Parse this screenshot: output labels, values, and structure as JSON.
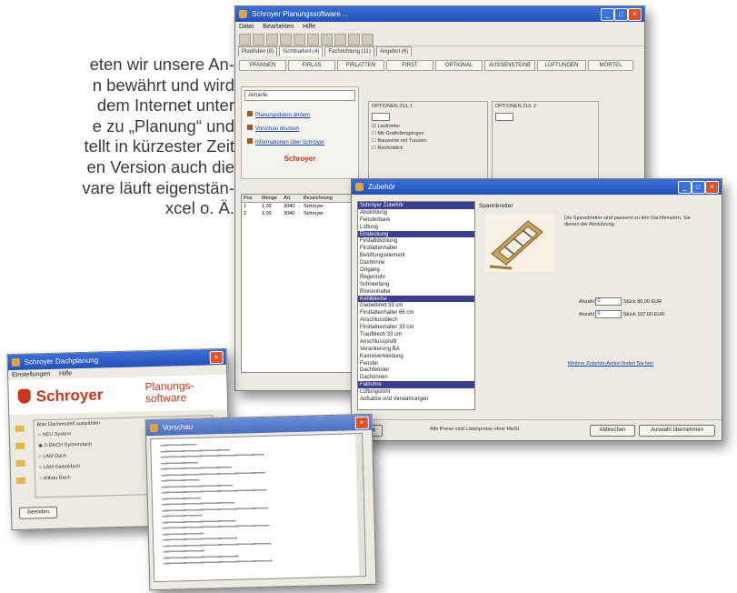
{
  "intro_lines": [
    "eten wir unsere An-",
    "n bewährt und wird",
    "dem Internet unter",
    "e zu „Planung“ und",
    "tellt in kürzester Zeit",
    "en Version auch die",
    "vare läuft eigenstän-",
    "xcel o. Ä."
  ],
  "colors": {
    "titlebar": "#2452b8",
    "brand": "#c8361b",
    "list_highlight": "#3b3f8f"
  },
  "main_window": {
    "title": "Schroyer Planungssoftware ...",
    "menu": [
      "Datei",
      "Bearbeiten",
      "Hilfe"
    ],
    "tabs": [
      "Planlisten (8)",
      "Sichtbarkeit (4)",
      "Fachrichtung (11)",
      "Angebot (6)"
    ],
    "section_bar": [
      "PFANNEN",
      "FIRLAS",
      "FIRLATTEN",
      "FIRST",
      "OPTIONAL",
      "AUSSENSTEINE",
      "LÜFTUNGEN",
      "MÖRTEL"
    ],
    "sidebar_title": "Aktuelle",
    "sidebar_links": [
      "Planungsdaten ändern",
      "Vorschau drucken",
      "Informationen über Schroyer"
    ],
    "sidebar_brand": "Schroyer",
    "group1_title": "OPTIONEN ZUL 1",
    "group1_options": [
      "Laufmeter",
      "Mit Gratfoliengängen",
      "Bauweise mit Trausen",
      "Rechtsblick"
    ],
    "group2_title": "OPTIONEN ZUL 2",
    "list_headers": [
      "Pos",
      "Menge",
      "Art.",
      "Bezeichnung"
    ],
    "list_rows": [
      [
        "1",
        "1,00",
        "3040",
        "Schroyer"
      ],
      [
        "2",
        "1,00",
        "3040",
        "Schroyer"
      ]
    ]
  },
  "detail_window": {
    "title": "Zubehör",
    "section_title": "Spannbretter",
    "list_items": [
      "Schroyer Zubehör",
      "Abdichtung",
      "Fensterbank",
      "Lüftung",
      "Eindeckung",
      "Firstabdichtung",
      "Firstlattenhalter",
      "Belüftungselement",
      "Dachrinne",
      "Ortgang",
      "Regenrohr",
      "Schneefang",
      "Rinnenhalter",
      "Kehlbleche",
      "Giebelbrett 33 cm",
      "Firstlattenhalter 66 cm",
      "Anschlussblech",
      "Firstlattenhalter 33 cm",
      "Traufblech 33 cm",
      "Anschlussprofil",
      "Verankerung BA",
      "Kaminverkleidung",
      "Fenster",
      "Dachfenster",
      "Dachrinnen",
      "Fallrohre",
      "Lüftungsrohr",
      "Aufsätze und Verwahrungen"
    ],
    "description": "Die Spannbretter sind passend zu den Dachfenstern. Sie dienen der Abstützung.",
    "qty_rows": [
      {
        "label": "Anzahl",
        "value": "0",
        "unit": "Stück",
        "price": "86,00 EUR"
      },
      {
        "label": "Anzahl",
        "value": "0",
        "unit": "Stück",
        "price": "107,00 EUR"
      }
    ],
    "hint_link": "Weitere Zubehör-Artikel finden Sie hier",
    "footer_help": "Hilfe",
    "footer_text": "Alle Preise sind Listenpreise ohne MwSt.",
    "btn_cancel": "Abbrechen",
    "btn_ok": "Auswahl übernehmen"
  },
  "start_window": {
    "title": "Schroyer Dachplanung",
    "menu": [
      "Einstellungen",
      "Hilfe"
    ],
    "logo_text": "Schroyer",
    "product_name": "Planungs-\nsoftware",
    "options_title": "Bitte Dachmodell auswählen",
    "options": [
      "NEU System",
      "Z-DACH Systemdach",
      "LAM Dach",
      "LAM Giebeldach",
      "Altbau Dach"
    ],
    "start_label": "Beenden"
  },
  "notes_window": {
    "title": "Vorschau"
  }
}
